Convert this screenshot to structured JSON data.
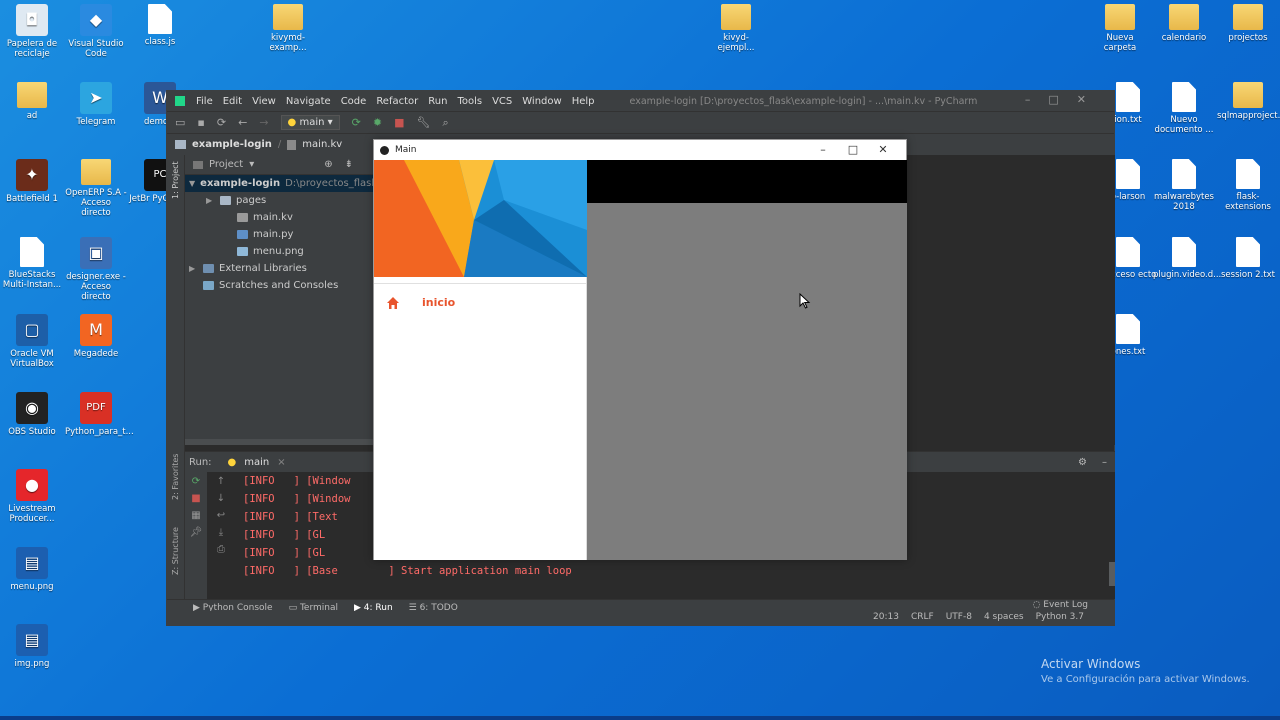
{
  "desktop": {
    "left_icons": [
      {
        "label": "Papelera de reciclaje",
        "icon": "recycle-bin-icon"
      },
      {
        "label": "Visual Studio Code",
        "icon": "vscode-icon"
      },
      {
        "label": "class.js",
        "icon": "file-icon"
      },
      {
        "label": "kivymd-examp...",
        "icon": "folder-icon"
      },
      {
        "label": "ad",
        "icon": "folder-icon"
      },
      {
        "label": "Telegram",
        "icon": "telegram-icon"
      },
      {
        "label": "demo.d",
        "icon": "word-icon"
      },
      {
        "label": "Battlefield 1",
        "icon": "game-icon"
      },
      {
        "label": "OpenERP S.A - Acceso directo",
        "icon": "folder-icon"
      },
      {
        "label": "JetBr PyCharm",
        "icon": "pycharm-icon"
      },
      {
        "label": "BlueStacks Multi-Instan...",
        "icon": "file-icon"
      },
      {
        "label": "designer.exe - Acceso directo",
        "icon": "designer-icon"
      },
      {
        "label": "Oracle VM VirtualBox",
        "icon": "virtualbox-icon"
      },
      {
        "label": "Megadede",
        "icon": "megadede-icon"
      },
      {
        "label": "OBS Studio",
        "icon": "obs-icon"
      },
      {
        "label": "Python_para_t...",
        "icon": "pdf-icon"
      },
      {
        "label": "Livestream Producer...",
        "icon": "livestream-icon"
      },
      {
        "label": "menu.png",
        "icon": "image-icon"
      },
      {
        "label": "img.png",
        "icon": "image-icon"
      }
    ],
    "right_icons": [
      {
        "label": "kivyd-ejempl...",
        "icon": "folder-icon"
      },
      {
        "label": "Nueva carpeta",
        "icon": "folder-icon"
      },
      {
        "label": "calendario",
        "icon": "folder-icon"
      },
      {
        "label": "projectos",
        "icon": "folder-icon"
      },
      {
        "label": "ion.txt",
        "icon": "file-icon"
      },
      {
        "label": "Nuevo documento ...",
        "icon": "file-icon"
      },
      {
        "label": "sqlmapproject...",
        "icon": "folder-icon"
      },
      {
        "label": "o-larson",
        "icon": "file-icon"
      },
      {
        "label": "malwarebytes 2018",
        "icon": "file-icon"
      },
      {
        "label": "flask-extensions",
        "icon": "file-icon"
      },
      {
        "label": "- Acceso ecto",
        "icon": "file-icon"
      },
      {
        "label": "plugin.video.d...",
        "icon": "file-icon"
      },
      {
        "label": "session 2.txt",
        "icon": "file-icon"
      },
      {
        "label": "ones.txt",
        "icon": "file-icon"
      }
    ],
    "activate_title": "Activar Windows",
    "activate_sub": "Ve a Configuración para activar Windows."
  },
  "pycharm": {
    "menu": [
      "File",
      "Edit",
      "View",
      "Navigate",
      "Code",
      "Refactor",
      "Run",
      "Tools",
      "VCS",
      "Window",
      "Help"
    ],
    "title": "example-login [D:\\proyectos_flask\\example-login] - ...\\main.kv - PyCharm",
    "run_config": "main",
    "breadcrumb_project": "example-login",
    "breadcrumb_file": "main.kv",
    "project_panel_title": "Project",
    "side_tab": "1: Project",
    "tree": [
      {
        "label": "example-login",
        "extra": "D:\\proyectos_flask\\",
        "indent": 0,
        "arrow": "▼",
        "kind": "folder"
      },
      {
        "label": "pages",
        "extra": "",
        "indent": 1,
        "arrow": "▶",
        "kind": "folder"
      },
      {
        "label": "main.kv",
        "extra": "",
        "indent": 2,
        "arrow": "",
        "kind": "kv"
      },
      {
        "label": "main.py",
        "extra": "",
        "indent": 2,
        "arrow": "",
        "kind": "py"
      },
      {
        "label": "menu.png",
        "extra": "",
        "indent": 2,
        "arrow": "",
        "kind": "png"
      },
      {
        "label": "External Libraries",
        "extra": "",
        "indent": 0,
        "arrow": "▶",
        "kind": "lib"
      },
      {
        "label": "Scratches and Consoles",
        "extra": "",
        "indent": 0,
        "arrow": "",
        "kind": "scratch"
      }
    ],
    "run_label": "Run:",
    "run_tab": "main",
    "log": [
      "[INFO   ] [Window",
      "[INFO   ] [Window",
      "[INFO   ] [Text",
      "[INFO   ] [GL",
      "[INFO   ] [GL",
      "[INFO   ] [Base        ] Start application main loop"
    ],
    "bottom_tabs": [
      "Python Console",
      "Terminal",
      "4: Run",
      "6: TODO"
    ],
    "event_log": "Event Log",
    "status": [
      "20:13",
      "CRLF",
      "UTF-8",
      "4 spaces",
      "Python 3.7"
    ],
    "left_tabs": [
      "2: Favorites",
      "Z: Structure"
    ]
  },
  "kivy_window": {
    "title": "Main",
    "nav_item": "inicio",
    "colors": {
      "accent": "#e8542d",
      "header_blue": "#1b8fd6",
      "orange": "#f26522",
      "yellow": "#f9a81b",
      "scrim": "#7d7d7d"
    }
  }
}
